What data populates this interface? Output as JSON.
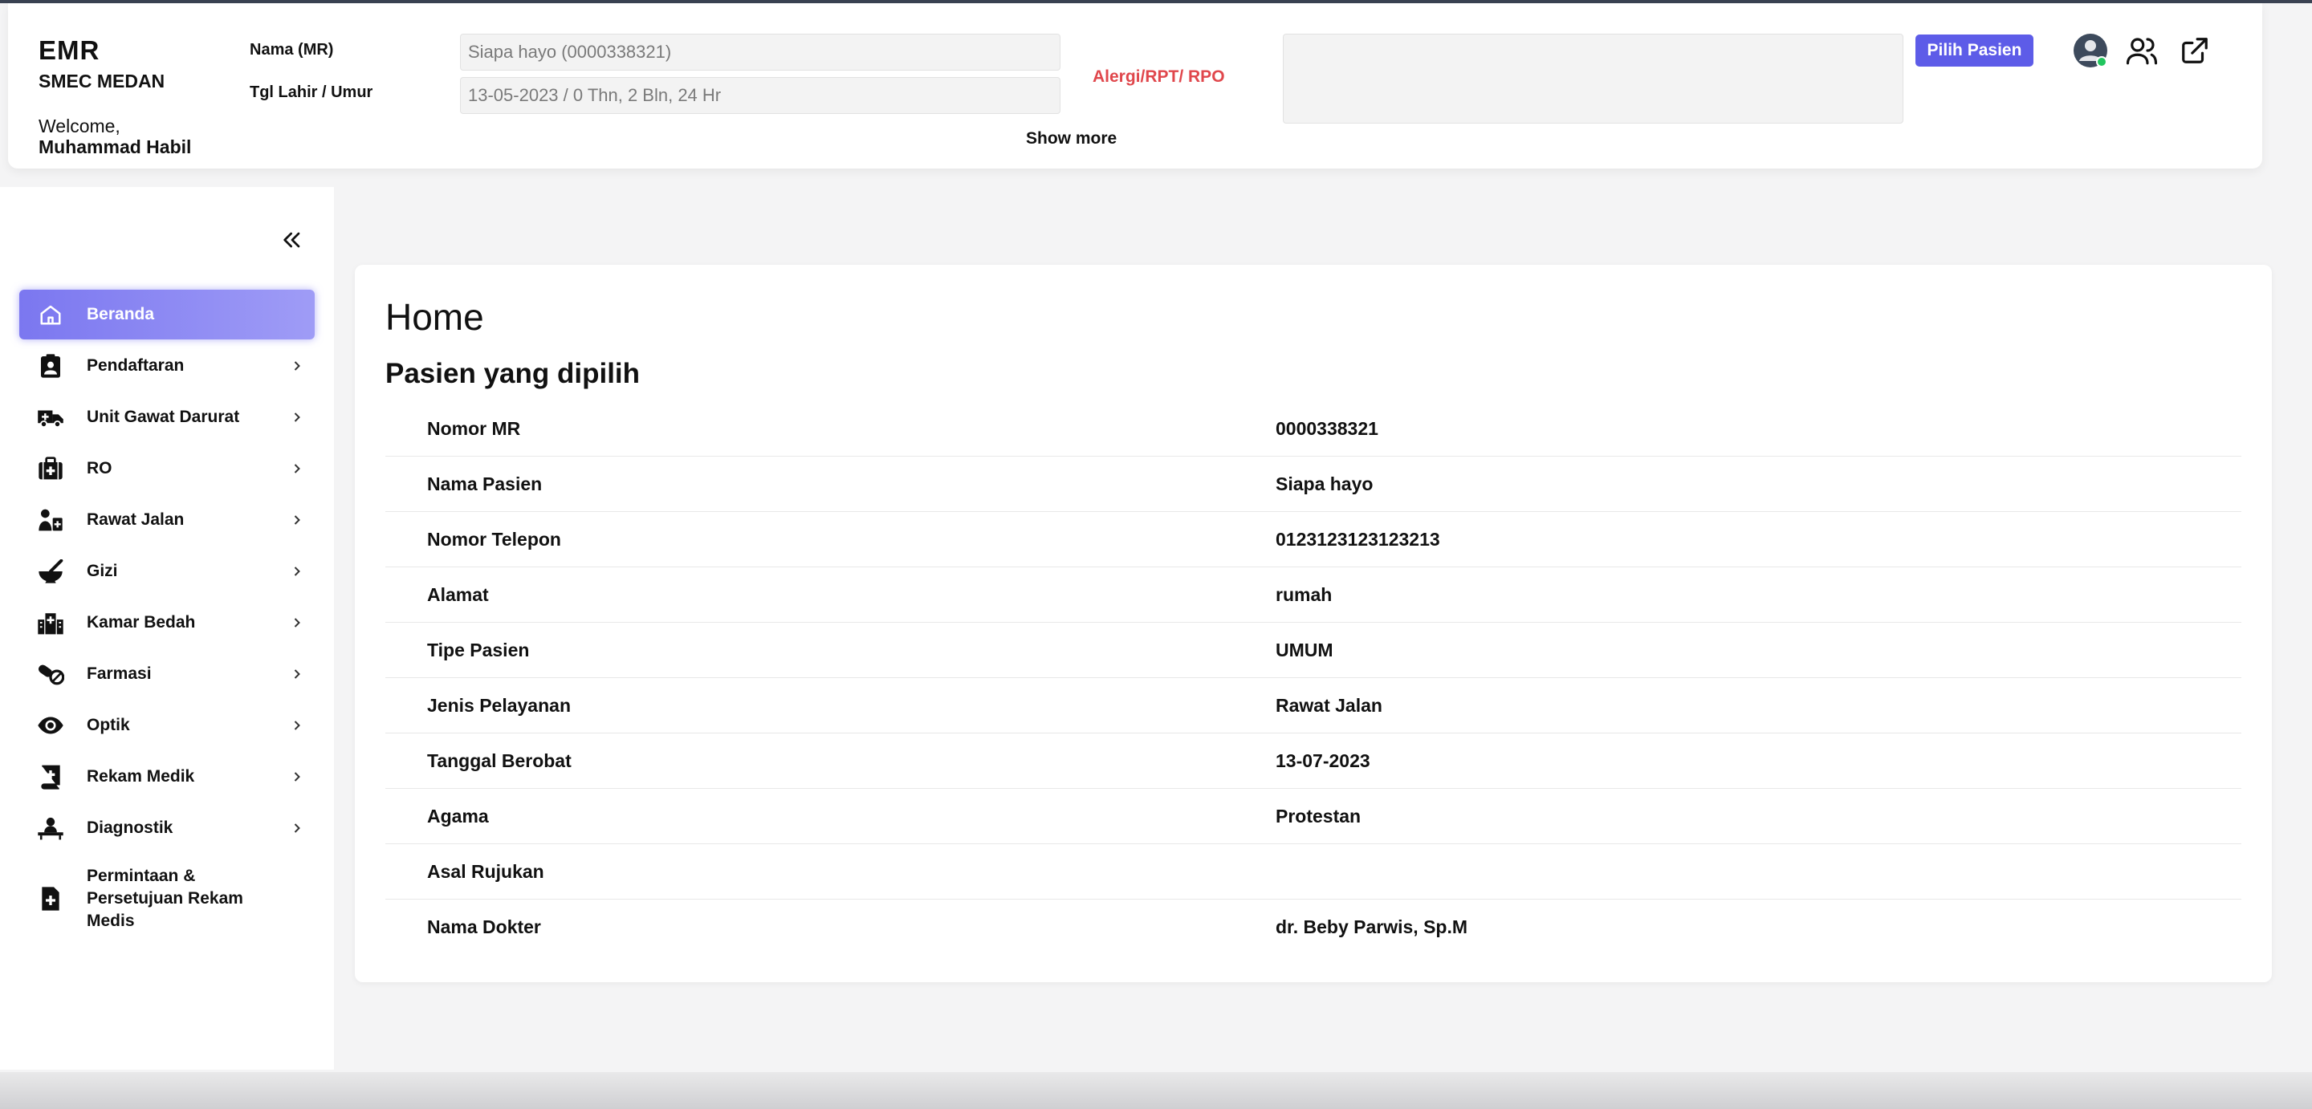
{
  "header": {
    "app_name": "EMR",
    "site": "SMEC MEDAN",
    "welcome_label": "Welcome,",
    "user_name": "Muhammad Habil",
    "name_label": "Nama (MR)",
    "name_value": "Siapa hayo (0000338321)",
    "dob_label": "Tgl Lahir / Umur",
    "dob_value": "13-05-2023 / 0 Thn, 2 Bln, 24 Hr",
    "allergy_label": "Alergi/RPT/ RPO",
    "allergy_value": "",
    "show_more": "Show more",
    "pick_patient": "Pilih Pasien"
  },
  "sidebar": {
    "items": [
      {
        "label": "Beranda",
        "icon": "home-icon",
        "active": true
      },
      {
        "label": "Pendaftaran",
        "icon": "clipboard-user-icon"
      },
      {
        "label": "Unit Gawat Darurat",
        "icon": "ambulance-icon"
      },
      {
        "label": "RO",
        "icon": "medical-kit-icon"
      },
      {
        "label": "Rawat Jalan",
        "icon": "patient-icon"
      },
      {
        "label": "Gizi",
        "icon": "mortar-pestle-icon"
      },
      {
        "label": "Kamar Bedah",
        "icon": "hospital-icon"
      },
      {
        "label": "Farmasi",
        "icon": "pills-icon"
      },
      {
        "label": "Optik",
        "icon": "eye-icon"
      },
      {
        "label": "Rekam Medik",
        "icon": "medical-book-icon"
      },
      {
        "label": "Diagnostik",
        "icon": "doctor-examination-icon"
      },
      {
        "label": "Permintaan & Persetujuan Rekam Medis",
        "icon": "file-medical-icon"
      }
    ]
  },
  "main": {
    "title": "Home",
    "section_title": "Pasien yang dipilih",
    "rows": [
      {
        "label": "Nomor MR",
        "value": "0000338321"
      },
      {
        "label": "Nama Pasien",
        "value": "Siapa hayo"
      },
      {
        "label": "Nomor Telepon",
        "value": "0123123123123213"
      },
      {
        "label": "Alamat",
        "value": "rumah"
      },
      {
        "label": "Tipe Pasien",
        "value": "UMUM"
      },
      {
        "label": "Jenis Pelayanan",
        "value": "Rawat Jalan"
      },
      {
        "label": "Tanggal Berobat",
        "value": "13-07-2023"
      },
      {
        "label": "Agama",
        "value": "Protestan"
      },
      {
        "label": "Asal Rujukan",
        "value": ""
      },
      {
        "label": "Nama Dokter",
        "value": "dr. Beby Parwis, Sp.M"
      }
    ]
  },
  "colors": {
    "accent": "#5d5ce8",
    "allergy": "#e0474c",
    "online_status": "#22c55e"
  }
}
